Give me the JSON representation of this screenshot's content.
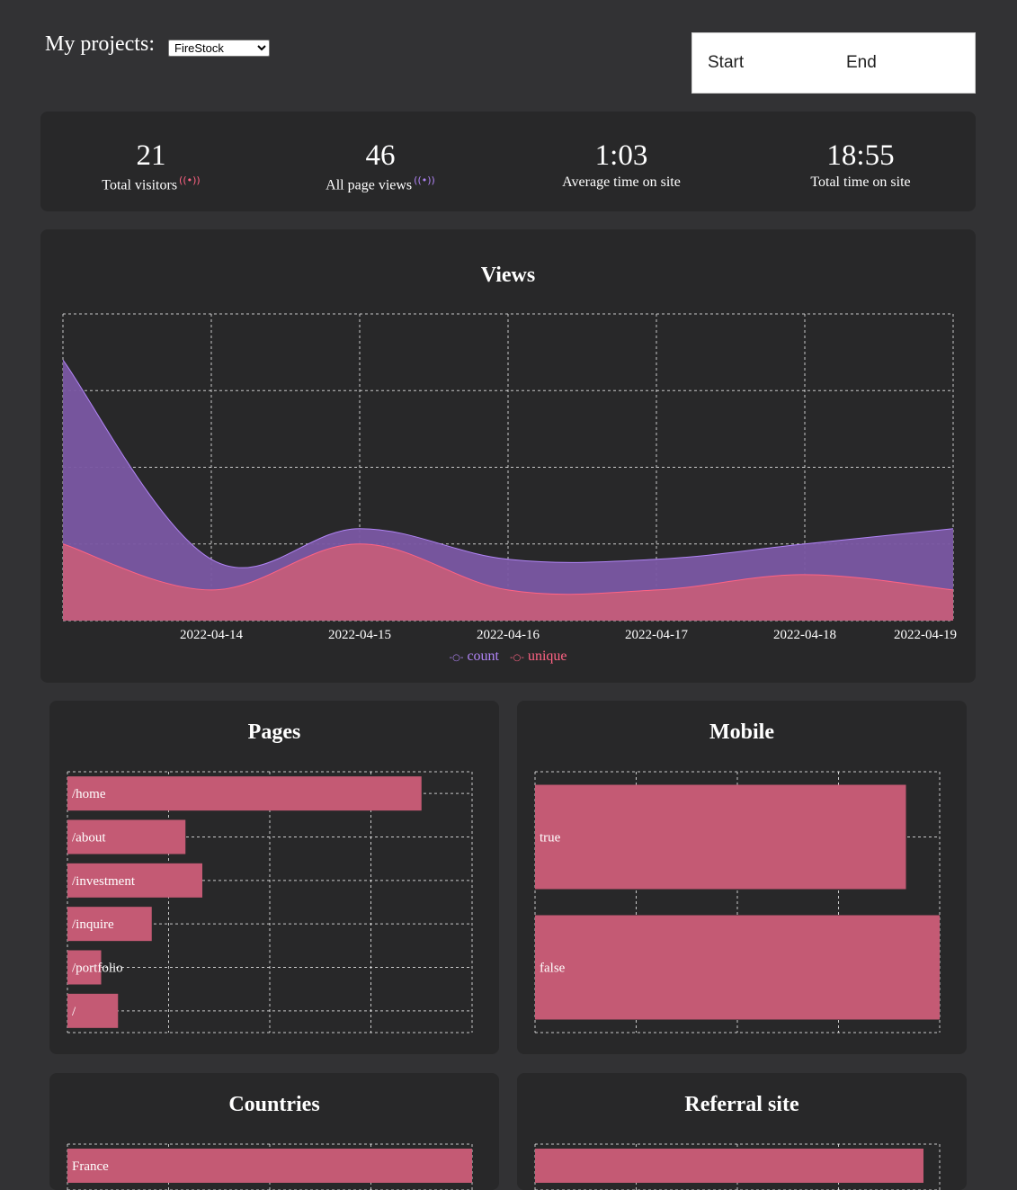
{
  "header": {
    "title": "My projects:",
    "project_selected": "FireStock"
  },
  "date_range": {
    "start_label": "Start",
    "end_label": "End"
  },
  "stats": {
    "total_visitors": {
      "value": "21",
      "label": "Total visitors",
      "icon": "live-signal-icon"
    },
    "page_views": {
      "value": "46",
      "label": "All page views",
      "icon": "live-signal-icon"
    },
    "avg_time": {
      "value": "1:03",
      "label": "Average time on site"
    },
    "total_time": {
      "value": "18:55",
      "label": "Total time on site"
    }
  },
  "colors": {
    "count": "#7a57a3",
    "unique": "#c45d7a",
    "count_legend": "#b084f5",
    "unique_legend": "#ff6384",
    "bar": "#c45a74"
  },
  "views": {
    "title": "Views",
    "chart_data": {
      "type": "area",
      "x": [
        "2022-04-13",
        "2022-04-14",
        "2022-04-15",
        "2022-04-16",
        "2022-04-17",
        "2022-04-18",
        "2022-04-19"
      ],
      "tick_labels": [
        "2022-04-14",
        "2022-04-15",
        "2022-04-16",
        "2022-04-17",
        "2022-04-18",
        "2022-04-19"
      ],
      "series": [
        {
          "name": "count",
          "values": [
            17,
            4,
            6,
            4,
            4,
            5,
            6
          ]
        },
        {
          "name": "unique",
          "values": [
            5,
            2,
            5,
            2,
            2,
            3,
            2
          ]
        }
      ],
      "ylim": [
        0,
        20
      ],
      "grid": true,
      "legend": "bottom"
    }
  },
  "pages": {
    "title": "Pages",
    "chart_data": {
      "type": "bar",
      "orientation": "horizontal",
      "categories": [
        "/home",
        "/about",
        "/investment",
        "/inquire",
        "/portfolio",
        "/"
      ],
      "values": [
        21,
        7,
        8,
        5,
        2,
        3
      ],
      "xlim": [
        0,
        24
      ],
      "grid": true
    }
  },
  "mobile": {
    "title": "Mobile",
    "chart_data": {
      "type": "bar",
      "orientation": "horizontal",
      "categories": [
        "true",
        "false"
      ],
      "values": [
        11,
        12
      ],
      "xlim": [
        0,
        12
      ],
      "grid": true
    }
  },
  "countries": {
    "title": "Countries",
    "chart_data": {
      "type": "bar",
      "orientation": "horizontal",
      "categories": [
        "France"
      ],
      "values": [
        1
      ],
      "xlim": [
        0,
        1
      ],
      "grid": true
    }
  },
  "referral": {
    "title": "Referral site",
    "chart_data": {
      "type": "bar",
      "orientation": "horizontal",
      "categories": [
        ""
      ],
      "values": [
        0.96
      ],
      "xlim": [
        0,
        1
      ],
      "grid": true
    }
  }
}
